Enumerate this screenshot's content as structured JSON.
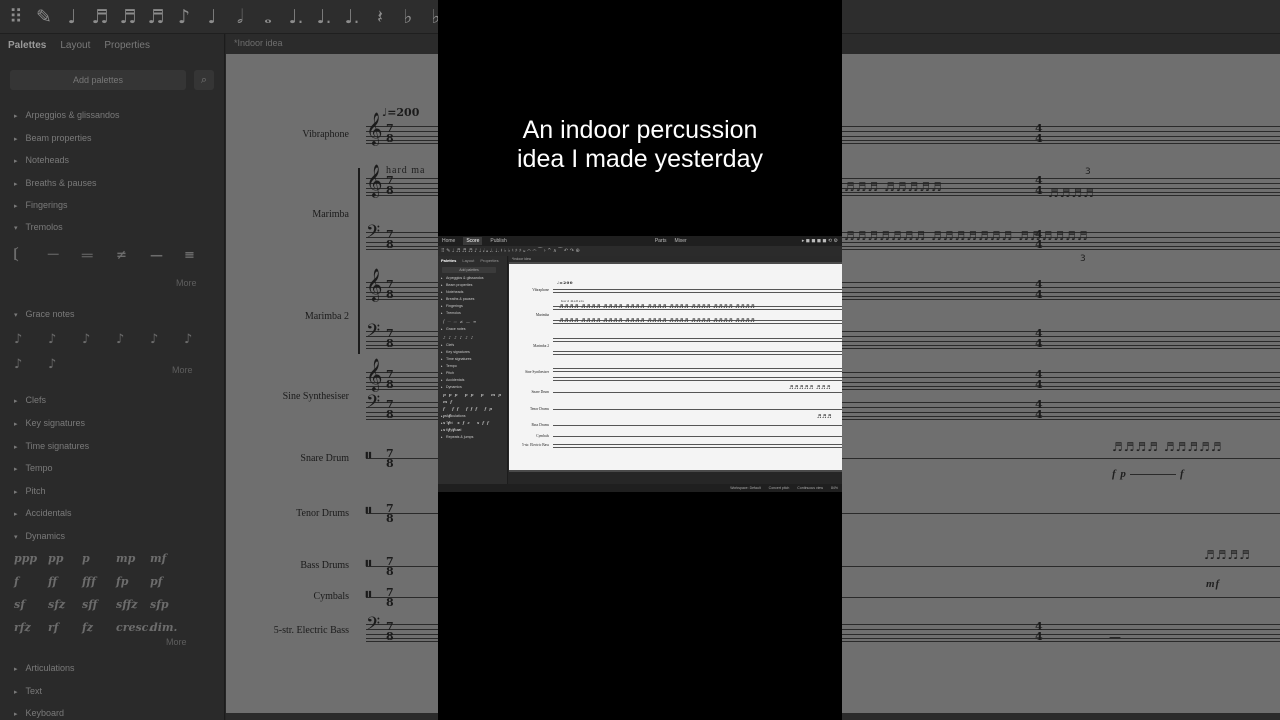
{
  "caption": {
    "line1": "An indoor percussion",
    "line2": "idea I made yesterday"
  },
  "background": {
    "panel_tabs": [
      "Palettes",
      "Layout",
      "Properties"
    ],
    "add_palettes": "Add palettes",
    "score_tab": "*Indoor idea",
    "palettes": [
      "Arpeggios & glissandos",
      "Beam properties",
      "Noteheads",
      "Breaths & pauses",
      "Fingerings",
      "Tremolos",
      "Grace notes",
      "Clefs",
      "Key signatures",
      "Time signatures",
      "Tempo",
      "Pitch",
      "Accidentals",
      "Dynamics",
      "Articulations",
      "Text",
      "Keyboard"
    ],
    "more": "More",
    "dynamics": [
      "ppp",
      "pp",
      "p",
      "mp",
      "mf",
      "f",
      "ff",
      "fff",
      "fp",
      "pf",
      "sf",
      "sfz",
      "sff",
      "sffz",
      "sfp",
      "rfz",
      "rf",
      "fz",
      "cresc.",
      "dim."
    ],
    "tempo_mark": "♩=200",
    "hard_mallet": "hard ma",
    "instruments": [
      "Vibraphone",
      "Marimba",
      "Marimba 2",
      "Sine Synthesiser",
      "Snare Drum",
      "Tenor Drums",
      "Bass Drums",
      "Cymbals",
      "5-str. Electric Bass"
    ],
    "time_signature": {
      "top": "7",
      "bottom": "8"
    },
    "time_signature_alt": {
      "top": "4",
      "bottom": "4"
    },
    "dyn_fp": "f p",
    "dyn_f": "f",
    "dyn_mf": "mf",
    "tuplet": "3"
  },
  "mini_app": {
    "menu": [
      "Home",
      "Score",
      "Publish"
    ],
    "menu_right": [
      "Parts",
      "Mixer"
    ],
    "panel_tabs": [
      "Palettes",
      "Layout",
      "Properties"
    ],
    "add_palettes": "Add palettes",
    "score_tab": "*Indoor idea",
    "palettes_top": [
      "Arpeggios & glissandos",
      "Beam properties",
      "Noteheads",
      "Breaths & pauses",
      "Fingerings",
      "Tremolos"
    ],
    "palettes_mid": [
      "Grace notes"
    ],
    "palettes_bottom": [
      "Clefs",
      "Key signatures",
      "Time signatures",
      "Tempo",
      "Pitch",
      "Accidentals",
      "Dynamics"
    ],
    "palettes_end": [
      "Articulations",
      "Text",
      "Keyboard",
      "Repeats & jumps"
    ],
    "tempo_mark": "♩=200",
    "hard_mallet": "hard mallets",
    "instruments": [
      "Vibraphone",
      "Marimba",
      "Marimba 2",
      "Sine Synthesiser",
      "Snare Drum",
      "Tenor Drums",
      "Bass Drums",
      "Cymbals",
      "5-str. Electric Bass"
    ],
    "status": [
      "Workspace: Default",
      "Concert pitch",
      "Continuous view",
      "84%"
    ]
  }
}
